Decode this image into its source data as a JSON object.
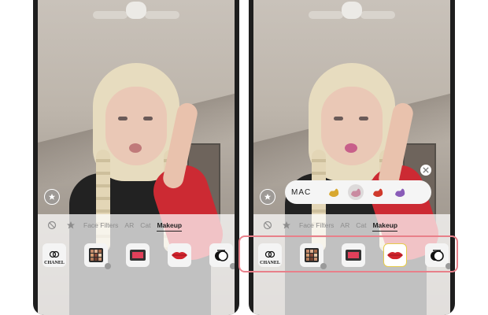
{
  "colors": {
    "highlight": "#e8808a",
    "selected_swatch": "#e6cc4c",
    "lip_red": "#d0242d"
  },
  "left_phone": {
    "tabs": [
      {
        "label": "Face Filters",
        "active": false
      },
      {
        "label": "AR",
        "active": false
      },
      {
        "label": "Cat",
        "active": false
      },
      {
        "label": "Makeup",
        "active": true
      }
    ],
    "effects": [
      {
        "label": "CHANEL",
        "icon": "chanel-logo-icon"
      },
      {
        "label": "",
        "icon": "eyeshadow-palette-icon"
      },
      {
        "label": "",
        "icon": "blush-compact-icon"
      },
      {
        "label": "",
        "icon": "lips-icon"
      },
      {
        "label": "",
        "icon": "mirror-compact-icon"
      }
    ]
  },
  "right_phone": {
    "brand_popup": {
      "brand": "MAC",
      "swatches": [
        {
          "color": "#d8a830",
          "selected": false
        },
        {
          "color": "#c98aa0",
          "selected": true
        },
        {
          "color": "#d03a2c",
          "selected": false
        },
        {
          "color": "#8a5cb8",
          "selected": false
        }
      ]
    },
    "tabs": [
      {
        "label": "Face Filters",
        "active": false
      },
      {
        "label": "AR",
        "active": false
      },
      {
        "label": "Cat",
        "active": false
      },
      {
        "label": "Makeup",
        "active": true
      }
    ],
    "effects": [
      {
        "label": "CHANEL",
        "icon": "chanel-logo-icon"
      },
      {
        "label": "",
        "icon": "eyeshadow-palette-icon"
      },
      {
        "label": "",
        "icon": "blush-compact-icon"
      },
      {
        "label": "",
        "icon": "lips-icon",
        "selected": true
      },
      {
        "label": "",
        "icon": "mirror-compact-icon"
      }
    ]
  }
}
